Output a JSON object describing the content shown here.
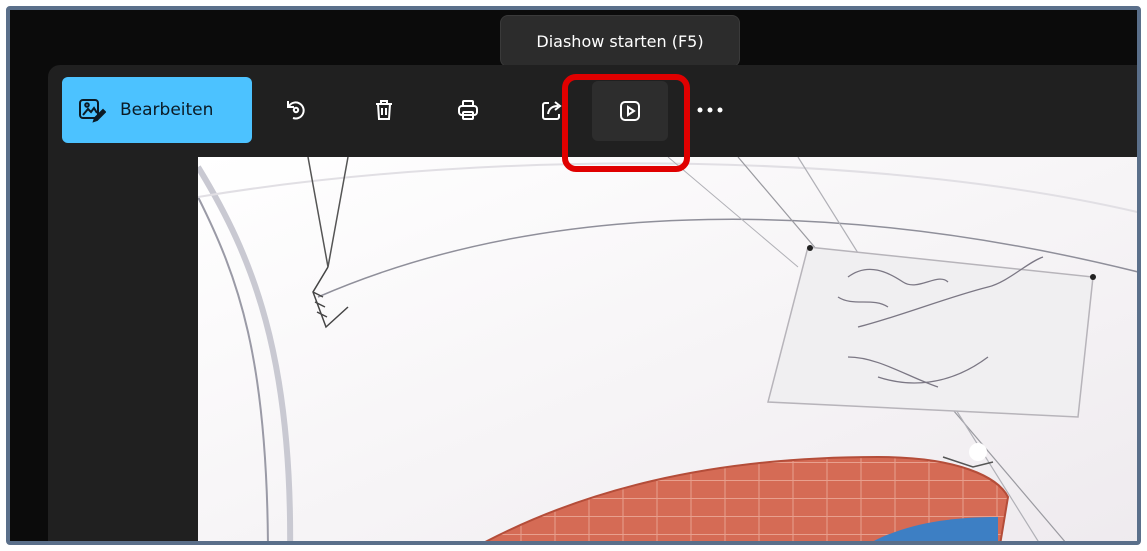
{
  "tooltip": {
    "text": "Diashow starten (F5)"
  },
  "toolbar": {
    "edit_label": "Bearbeiten",
    "buttons": [
      {
        "name": "rotate-button",
        "icon": "rotate-icon"
      },
      {
        "name": "delete-button",
        "icon": "trash-icon"
      },
      {
        "name": "print-button",
        "icon": "printer-icon"
      },
      {
        "name": "share-button",
        "icon": "share-icon"
      },
      {
        "name": "slideshow-button",
        "icon": "play-icon"
      },
      {
        "name": "more-button",
        "icon": "more-icon"
      }
    ]
  },
  "colors": {
    "accent": "#4cc2ff",
    "highlight": "#e00000",
    "toolbar_bg": "#202020"
  }
}
